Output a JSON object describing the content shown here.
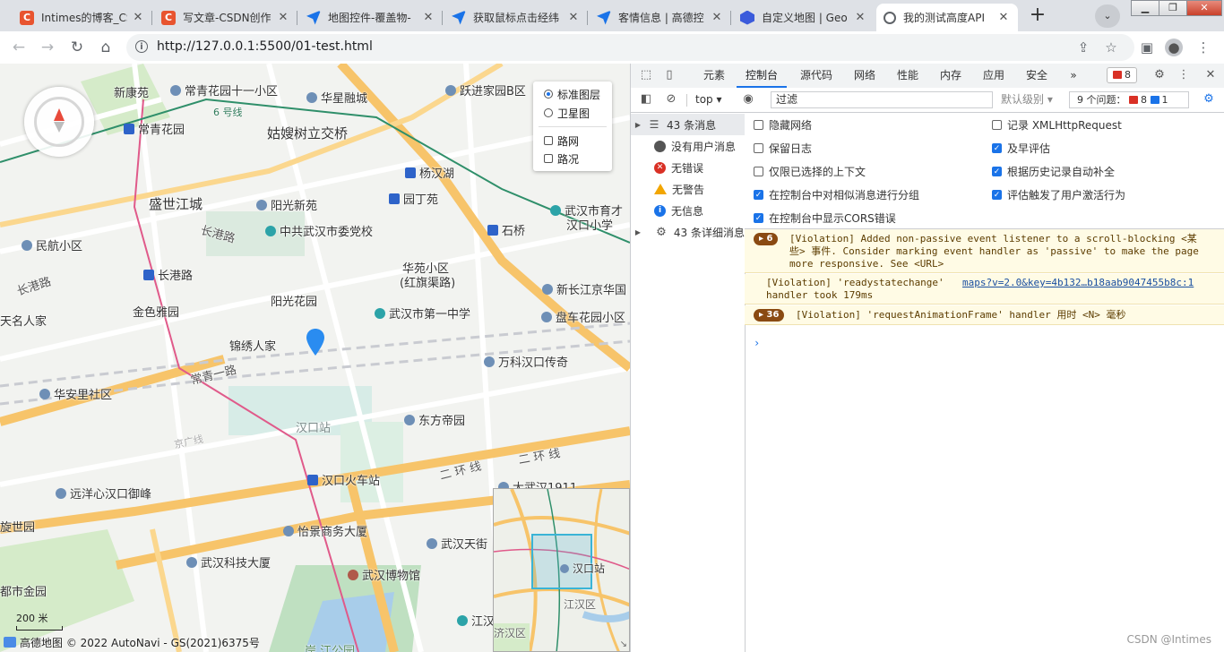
{
  "browser": {
    "tabs": [
      {
        "title": "Intimes的博客_CS",
        "favicon": "C",
        "favicon_color": "#e8542f"
      },
      {
        "title": "写文章-CSDN创作",
        "favicon": "C",
        "favicon_color": "#e8542f"
      },
      {
        "title": "地图控件-覆盖物-",
        "favicon": "",
        "favicon_color": "#1a73e8"
      },
      {
        "title": "获取鼠标点击经纬",
        "favicon": "",
        "favicon_color": "#1a73e8"
      },
      {
        "title": "客情信息 | 高德控",
        "favicon": "",
        "favicon_color": "#1a73e8"
      },
      {
        "title": "自定义地图 | Geo",
        "favicon": "",
        "favicon_color": "#3b5bdb"
      },
      {
        "title": "我的测试高度API",
        "favicon": "",
        "favicon_color": "#5f6368"
      }
    ],
    "active_tab": 6,
    "new_tab_label": "+",
    "tab_menu_label": "⌄",
    "url": "http://127.0.0.1:5500/01-test.html"
  },
  "map": {
    "labels": {
      "xinkangyuan": "新康苑",
      "changqing11": "常青花园十一小区",
      "huali": "华星融城",
      "yuejin": "跃进家园B区",
      "line6": "6 号线",
      "changqinghuayuan": "常青花园",
      "gusao": "姑嫂树立交桥",
      "yangwanhu": "杨汉湖",
      "shengshi": "盛世江城",
      "yangguangxinyuan": "阳光新苑",
      "dingyuan": "园丁苑",
      "changgangroad": "长港路",
      "weidang": "中共武汉市委党校",
      "shiqiao": "石桥",
      "wuhanyucai": "武汉市育才",
      "hankouxiaoxue": "汉口小学",
      "minhang": "民航小区",
      "changgangstation": "长港路",
      "changgang2": "长港路",
      "huayuan": "华苑小区",
      "hongqi": "(红旗渠路)",
      "xinchangjiang": "新长江京华国",
      "yangguanghuayuan": "阳光花园",
      "jinseyayuan": "金色雅园",
      "yizhong": "武汉市第一中学",
      "panjia": "盘车花园小区",
      "tianmingrenjia": "天名人家",
      "jinxiu": "锦绣人家",
      "changqingroad": "常青一路",
      "wanke": "万科汉口传奇",
      "huaan": "华安里社区",
      "hankouzhan": "汉口站",
      "dongfang": "东方帝园",
      "jingguang": "京广线",
      "erhuan1": "二 环 线",
      "erhuan2": "二 环 线",
      "hankouhuoche": "汉口火车站",
      "dawuhan": "大武汉1911",
      "yuanyang": "远洋心汉口御峰",
      "xuanshi": "旋世园",
      "yijing": "怡景商务大厦",
      "wuhantianjie": "武汉天街",
      "keji": "武汉科技大厦",
      "bowuguan": "武汉博物馆",
      "dushijin": "都市金园",
      "jiang": "江汉",
      "jiangpark": "岸 江公园"
    },
    "layers": {
      "standard": "标准图层",
      "satellite": "卫星图",
      "roadnet": "路网",
      "traffic": "路况"
    },
    "overview": {
      "station": "汉口站",
      "district": "江汉区",
      "area": "济汉区"
    },
    "scale": "200 米",
    "copyright": "高德地图 © 2022 AutoNavi - GS(2021)6375号"
  },
  "devtools": {
    "tabs": [
      "元素",
      "控制台",
      "源代码",
      "网络",
      "性能",
      "内存",
      "应用",
      "安全"
    ],
    "active_tab": 1,
    "more": "»",
    "error_badge": "8",
    "context": "top ▾",
    "filter_placeholder": "过滤",
    "levels": "默认级别 ▾",
    "issues": "9 个问题：",
    "issues_err": "8",
    "issues_info": "1",
    "sidebar": [
      {
        "label": "43 条消息",
        "icon": "list-icon"
      },
      {
        "label": "没有用户消息",
        "icon": "user-icon"
      },
      {
        "label": "无错误",
        "icon": "error-icon"
      },
      {
        "label": "无警告",
        "icon": "warning-icon"
      },
      {
        "label": "无信息",
        "icon": "info-icon"
      },
      {
        "label": "43 条详细消息",
        "icon": "gear-icon"
      }
    ],
    "settings": {
      "hide_network": "隐藏网络",
      "preserve_log": "保留日志",
      "selected_context": "仅限已选择的上下文",
      "group_similar": "在控制台中对相似消息进行分组",
      "cors_errors": "在控制台中显示CORS错误",
      "log_xhr": "记录 XMLHttpRequest",
      "eager_eval": "及早评估",
      "autocomplete_history": "根据历史记录自动补全",
      "eval_user_activation": "评估触发了用户激活行为"
    },
    "messages": [
      {
        "count": "6",
        "text": "[Violation] Added non-passive event listener to a scroll-blocking <某\n些> 事件. Consider marking event handler as 'passive' to make the page\nmore responsive. See <URL>"
      },
      {
        "count": "",
        "text": "[Violation] 'readystatechange'",
        "link": "maps?v=2.0&key=4b132…b18aab9047455b8c:1",
        "text2": "handler took 179ms"
      },
      {
        "count": "36",
        "text": "[Violation] 'requestAnimationFrame' handler 用时 <N> 毫秒"
      }
    ],
    "prompt": "›"
  },
  "watermark": "CSDN @Intimes"
}
